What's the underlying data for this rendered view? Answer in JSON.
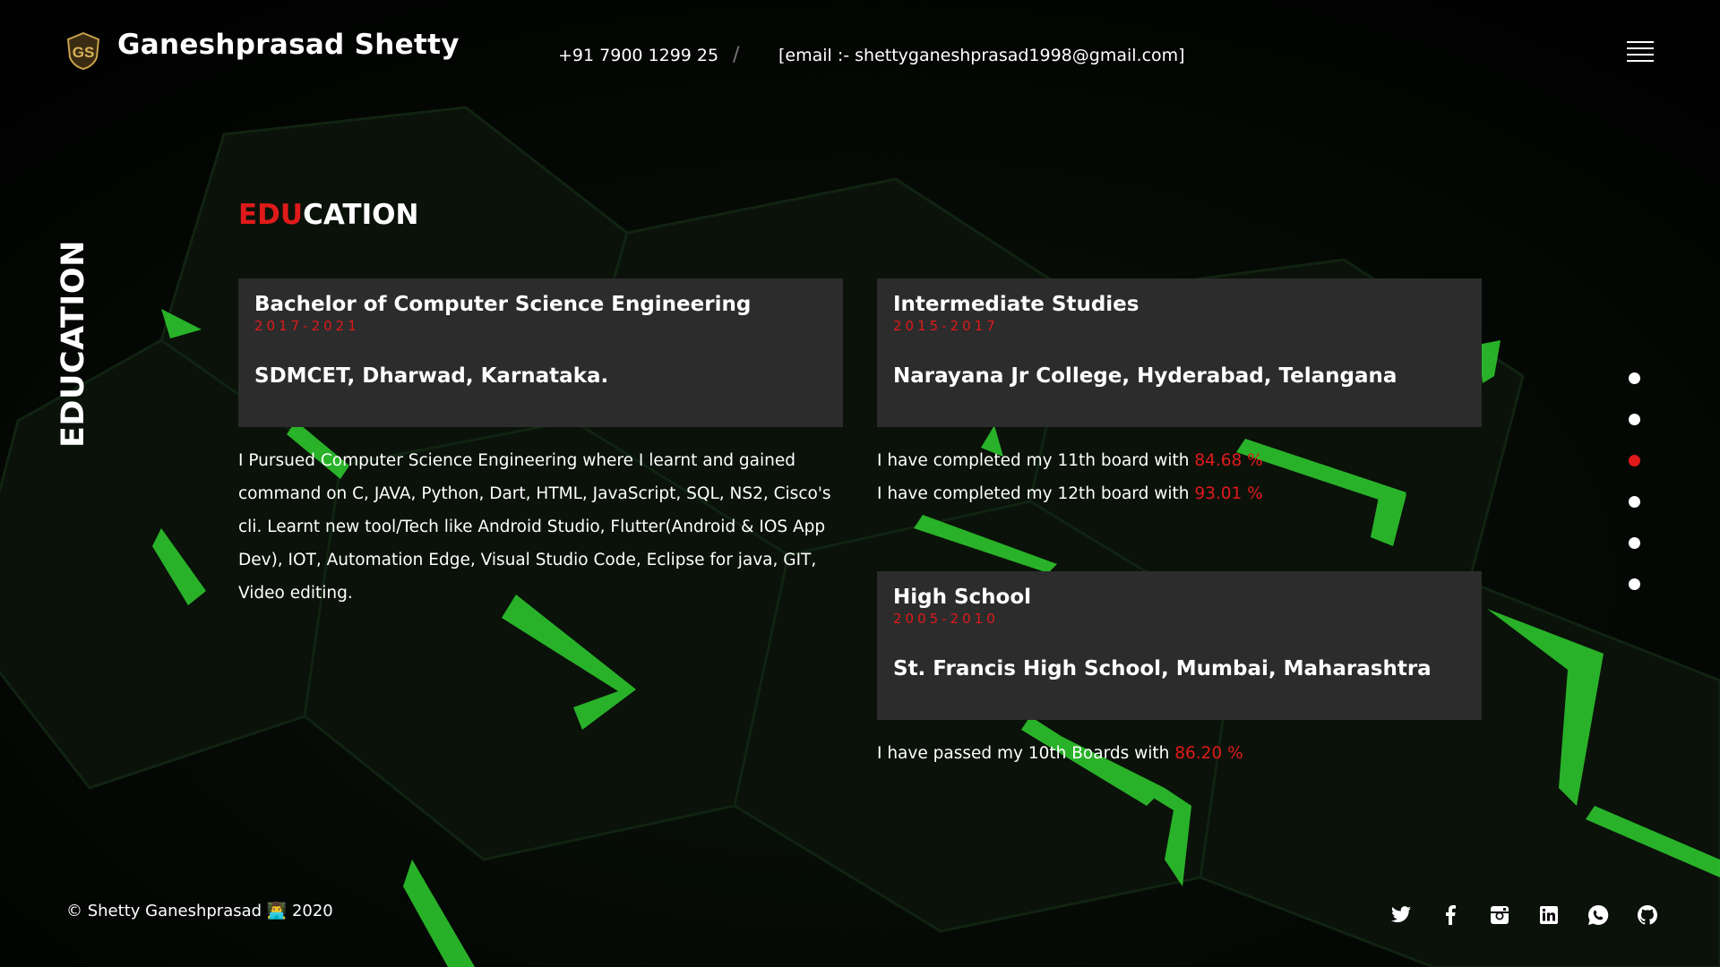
{
  "header": {
    "brand_name": "Ganeshprasad Shetty",
    "logo_text": "GS",
    "phone": "+91 7900 1299 25",
    "separator": "/",
    "email": "[email :- shettyganeshprasad1998@gmail.com]",
    "menu_icon": "hamburger-menu-icon"
  },
  "side_title": "EDUCATION",
  "section": {
    "heading_accent": "EDU",
    "heading_rest": "CATION"
  },
  "education": [
    {
      "title": "Bachelor of Computer Science Engineering",
      "years": "2017-2021",
      "school": "SDMCET, Dharwad, Karnataka.",
      "description": "I Pursued Computer Science Engineering where I learnt and gained command on C, JAVA, Python, Dart, HTML, JavaScript, SQL, NS2, Cisco's cli. Learnt new tool/Tech like Android Studio, Flutter(Android & IOS App Dev), IOT, Automation Edge, Visual Studio Code, Eclipse for java, GIT, Video editing."
    },
    {
      "title": "Intermediate Studies",
      "years": "2015-2017",
      "school": "Narayana Jr College, Hyderabad, Telangana",
      "lines": [
        {
          "text": "I have completed my 11th board with ",
          "value": "84.68 %"
        },
        {
          "text": "I have completed my 12th board with ",
          "value": "93.01 %"
        }
      ]
    },
    {
      "title": "High School",
      "years": "2005-2010",
      "school": "St. Francis High School, Mumbai, Maharashtra",
      "lines": [
        {
          "text": "I have passed my 10th Boards with ",
          "value": "86.20 %"
        }
      ]
    }
  ],
  "nav_dots": {
    "count": 6,
    "active_index": 2
  },
  "footer": {
    "copyright_prefix": "© Shetty Ganeshprasad",
    "emoji": "👨‍💻",
    "year": "2020",
    "social_icons": [
      "twitter-icon",
      "facebook-icon",
      "instagram-icon",
      "linkedin-icon",
      "whatsapp-icon",
      "github-icon"
    ]
  },
  "colors": {
    "accent": "#e01a1a",
    "card_bg": "#2c2c2c",
    "background": "#030503",
    "glow_green": "#3bd43b"
  }
}
